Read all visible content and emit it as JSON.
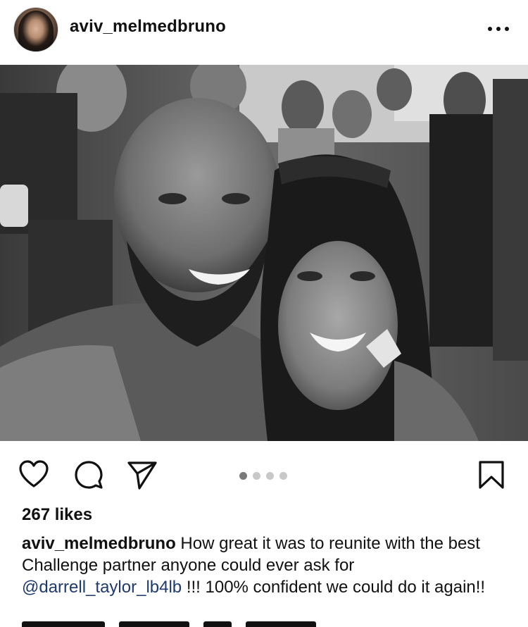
{
  "post": {
    "username": "aviv_melmedbruno",
    "more_icon": "more-horizontal-icon",
    "photo_icon": "photo",
    "carousel": {
      "total": 4,
      "active": 1
    },
    "likes": "267 likes",
    "caption": {
      "username": "aviv_melmedbruno",
      "text_before": " How great it was to reunite with the best Challenge partner anyone could ever ask for ",
      "mention": "@darrell_taylor_lb4lb",
      "text_after": " !!! 100% confident we could do it again!!"
    }
  },
  "actions": {
    "like_icon": "heart-icon",
    "comment_icon": "comment-icon",
    "share_icon": "send-icon",
    "save_icon": "bookmark-icon"
  },
  "colors": {
    "text": "#111111",
    "mention": "#1e3a6e",
    "dot_active": "#7a7a7a",
    "dot_inactive": "#c8c8c8"
  }
}
